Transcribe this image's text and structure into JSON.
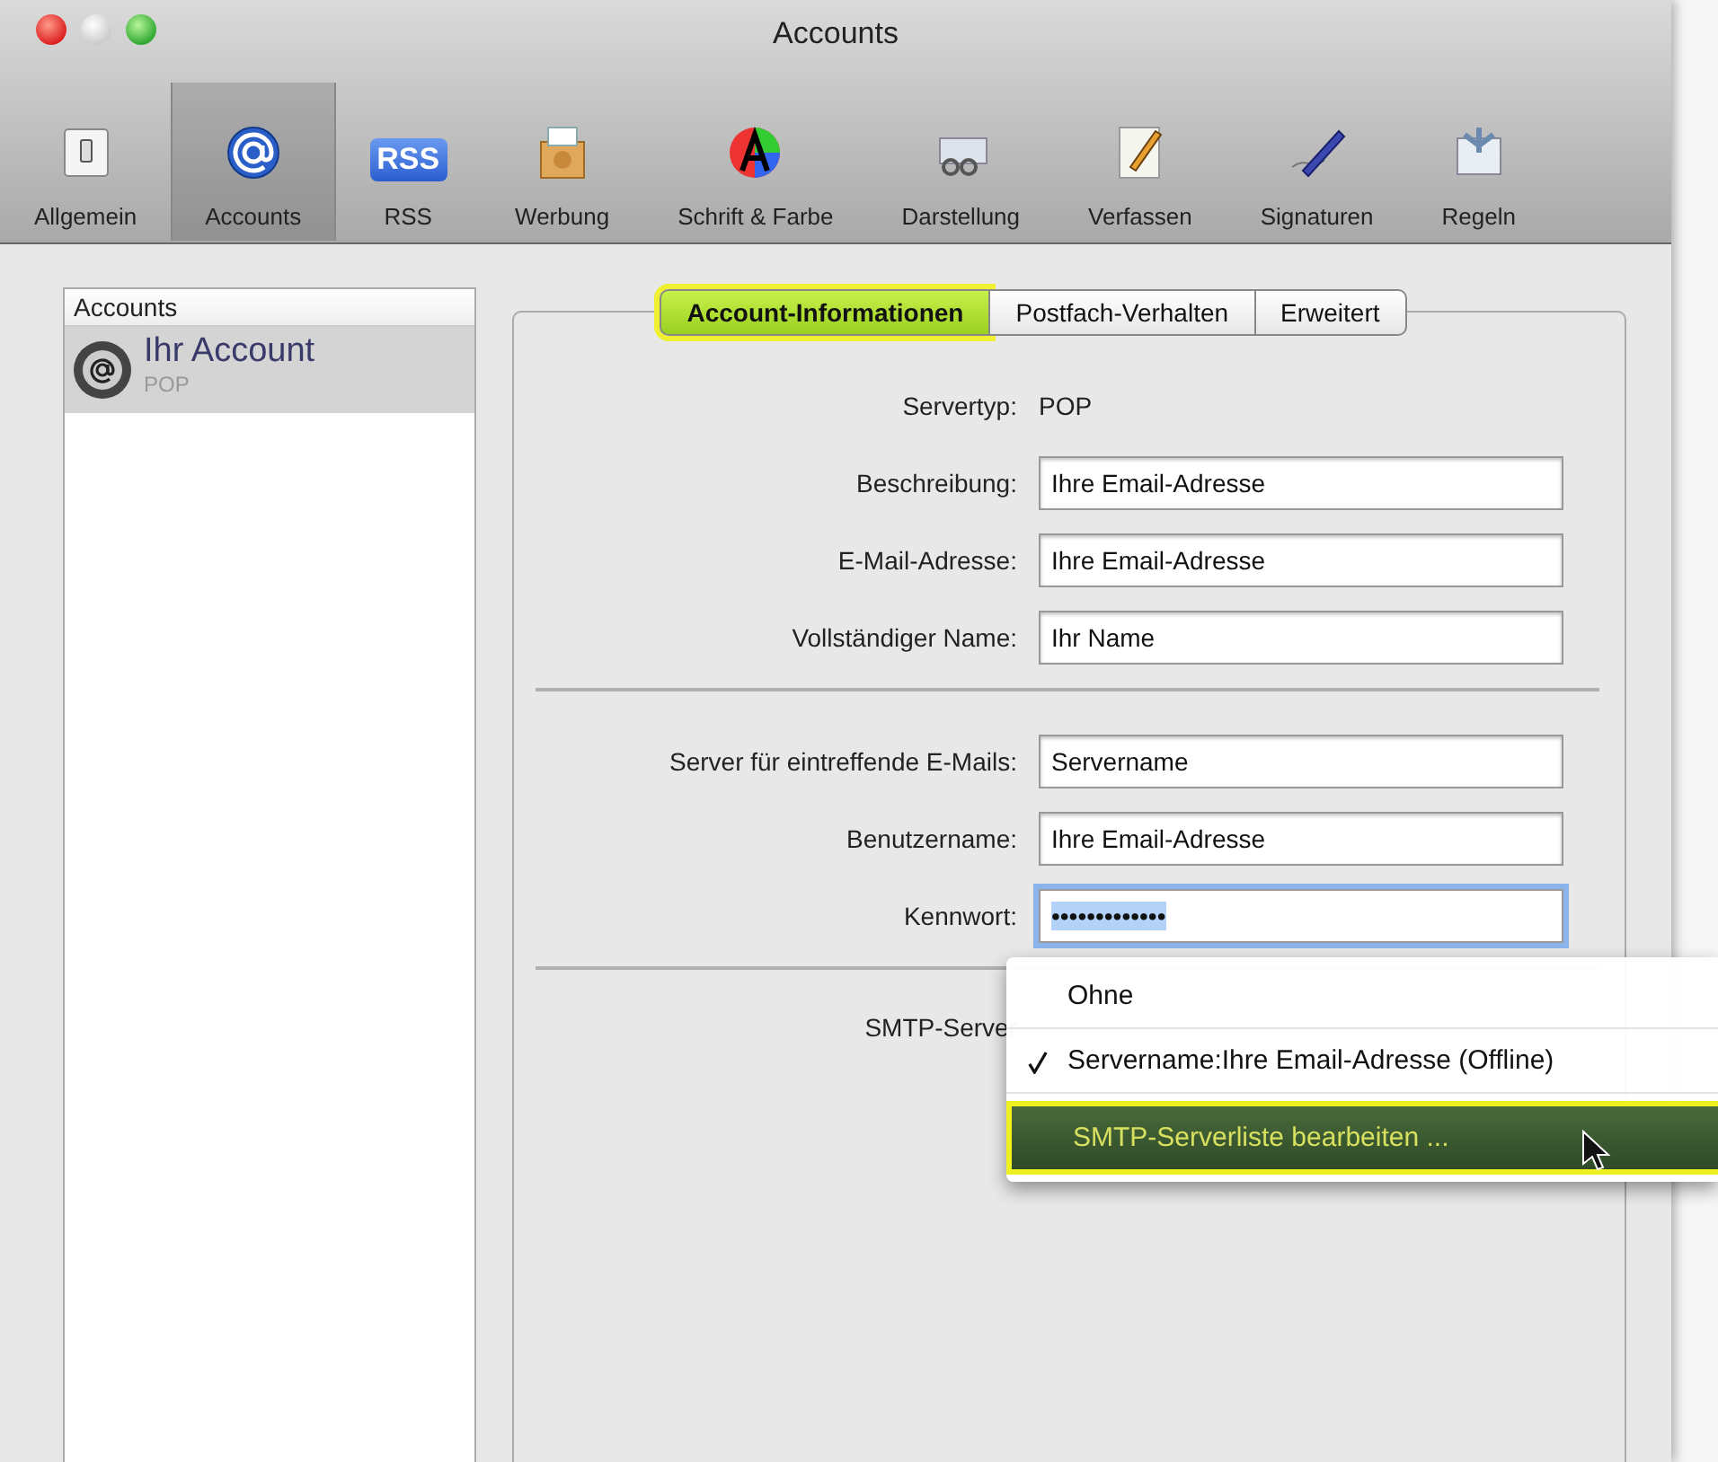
{
  "window": {
    "title": "Accounts"
  },
  "toolbar": [
    {
      "label": "Allgemein",
      "selected": false
    },
    {
      "label": "Accounts",
      "selected": true
    },
    {
      "label": "RSS",
      "selected": false,
      "badge": "RSS"
    },
    {
      "label": "Werbung",
      "selected": false
    },
    {
      "label": "Schrift & Farbe",
      "selected": false
    },
    {
      "label": "Darstellung",
      "selected": false
    },
    {
      "label": "Verfassen",
      "selected": false
    },
    {
      "label": "Signaturen",
      "selected": false
    },
    {
      "label": "Regeln",
      "selected": false
    }
  ],
  "accounts_list": {
    "header": "Accounts",
    "items": [
      {
        "name": "Ihr Account",
        "type": "POP",
        "selected": true
      }
    ]
  },
  "tabs": [
    {
      "label": "Account-Informationen",
      "selected": true
    },
    {
      "label": "Postfach-Verhalten",
      "selected": false
    },
    {
      "label": "Erweitert",
      "selected": false
    }
  ],
  "form": [
    {
      "kind": "static",
      "label": "Servertyp:",
      "value": "POP"
    },
    {
      "kind": "field",
      "label": "Beschreibung:",
      "value": "Ihre Email-Adresse",
      "focused": false
    },
    {
      "kind": "field",
      "label": "E-Mail-Adresse:",
      "value": "Ihre Email-Adresse",
      "focused": false
    },
    {
      "kind": "field",
      "label": "Vollständiger Name:",
      "value": "Ihr Name",
      "focused": false
    },
    {
      "kind": "separator"
    },
    {
      "kind": "field",
      "label": "Server für eintreffende E-Mails:",
      "value": "Servername",
      "focused": false
    },
    {
      "kind": "field",
      "label": "Benutzername:",
      "value": "Ihre Email-Adresse",
      "focused": false
    },
    {
      "kind": "field",
      "label": "Kennwort:",
      "value": "•••••••••••••",
      "focused": true
    },
    {
      "kind": "separator"
    },
    {
      "kind": "popup",
      "label": "SMTP-Server"
    }
  ],
  "smtp_menu": [
    {
      "label": "Ohne",
      "checked": false,
      "highlighted": false
    },
    {
      "label": "Servername:Ihre Email-Adresse (Offline)",
      "checked": true,
      "highlighted": false
    },
    {
      "label": "SMTP-Serverliste bearbeiten ...",
      "checked": false,
      "highlighted": true
    }
  ]
}
